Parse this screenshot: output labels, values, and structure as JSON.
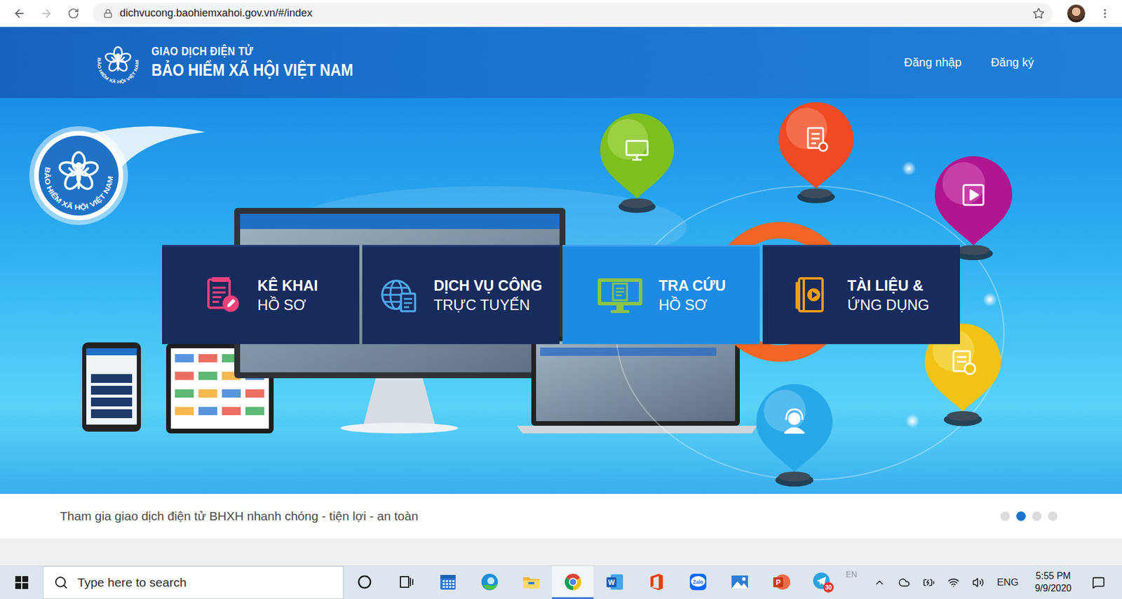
{
  "browser": {
    "url": "dichvucong.baohiemxahoi.gov.vn/#/index",
    "back_enabled": true,
    "forward_enabled": false
  },
  "header": {
    "logo_text": "BẢO HIỂM XÃ HỘI VIỆT NAM",
    "title_small": "GIAO DỊCH ĐIỆN TỬ",
    "title_large": "BẢO HIỂM XÃ HỘI VIỆT NAM",
    "links": [
      "Đăng nhập",
      "Đăng ký"
    ]
  },
  "banner": {
    "logo_text": "BẢO HIỂM XÃ HỘI VIỆT NAM",
    "tiles": [
      {
        "kind": "declare",
        "line1": "KÊ KHAI",
        "line2": "HỒ SƠ",
        "color": "#ec407a",
        "selected": false
      },
      {
        "kind": "online-service",
        "line1": "DỊCH VỤ CÔNG",
        "line2": "TRỰC TUYẾN",
        "color": "#4fa8e6",
        "selected": false
      },
      {
        "kind": "lookup",
        "line1": "TRA CỨU",
        "line2": "HỒ SƠ",
        "color": "#8bc34a",
        "selected": true
      },
      {
        "kind": "documents",
        "line1": "TÀI LIỆU &",
        "line2": "ỨNG DỤNG",
        "color": "#f39c12",
        "selected": false
      }
    ]
  },
  "caption": {
    "text": "Tham gia giao dịch điện tử BHXH nhanh chóng - tiện lợi - an toàn",
    "dots": [
      {
        "selected": false
      },
      {
        "selected": true
      },
      {
        "selected": false
      },
      {
        "selected": false
      }
    ]
  },
  "taskbar": {
    "search_placeholder": "Type here to search",
    "apps": [
      {
        "kind": "cortana",
        "active": false
      },
      {
        "kind": "task-view",
        "active": false
      },
      {
        "kind": "calendar",
        "active": false
      },
      {
        "kind": "edge",
        "active": false
      },
      {
        "kind": "explorer",
        "active": false
      },
      {
        "kind": "chrome",
        "active": true
      },
      {
        "kind": "word",
        "label": "W",
        "active": false
      },
      {
        "kind": "office",
        "active": false
      },
      {
        "kind": "zalo",
        "label": "Zalo",
        "active": false
      },
      {
        "kind": "photos",
        "active": false
      },
      {
        "kind": "powerpoint",
        "label": "P",
        "active": false
      },
      {
        "kind": "telegram",
        "badge": "30",
        "active": false
      }
    ],
    "tray": {
      "floating_lang": "EN",
      "language": "ENG",
      "time": "5:55 PM",
      "date": "9/9/2020"
    }
  }
}
